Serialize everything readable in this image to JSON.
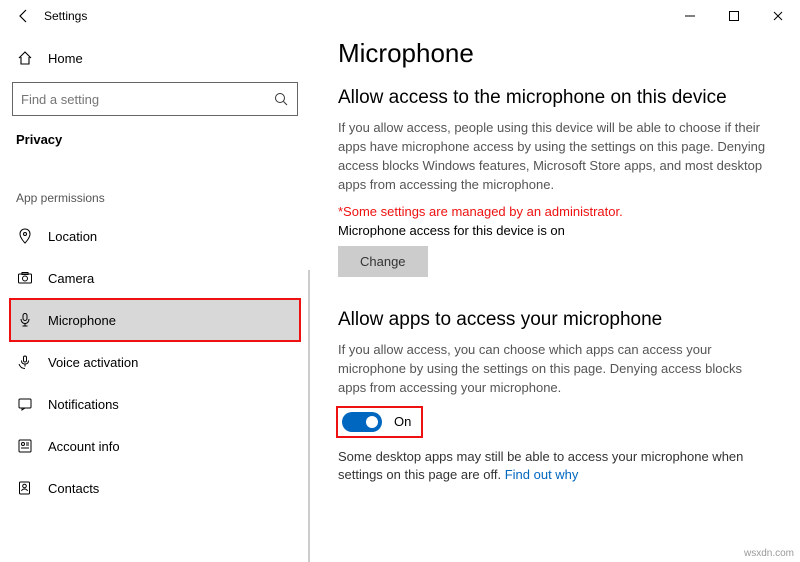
{
  "window": {
    "title": "Settings"
  },
  "sidebar": {
    "home": "Home",
    "search_placeholder": "Find a setting",
    "category": "Privacy",
    "section": "App permissions",
    "items": [
      {
        "label": "Location"
      },
      {
        "label": "Camera"
      },
      {
        "label": "Microphone"
      },
      {
        "label": "Voice activation"
      },
      {
        "label": "Notifications"
      },
      {
        "label": "Account info"
      },
      {
        "label": "Contacts"
      }
    ]
  },
  "main": {
    "title": "Microphone",
    "section1": {
      "heading": "Allow access to the microphone on this device",
      "desc": "If you allow access, people using this device will be able to choose if their apps have microphone access by using the settings on this page. Denying access blocks Windows features, Microsoft Store apps, and most desktop apps from accessing the microphone.",
      "admin_note": "*Some settings are managed by an administrator.",
      "status": "Microphone access for this device is on",
      "change_btn": "Change"
    },
    "section2": {
      "heading": "Allow apps to access your microphone",
      "desc": "If you allow access, you can choose which apps can access your microphone by using the settings on this page. Denying access blocks apps from accessing your microphone.",
      "toggle_state": "On",
      "footer": "Some desktop apps may still be able to access your microphone when settings on this page are off. ",
      "link": "Find out why"
    }
  },
  "watermark": "wsxdn.com"
}
